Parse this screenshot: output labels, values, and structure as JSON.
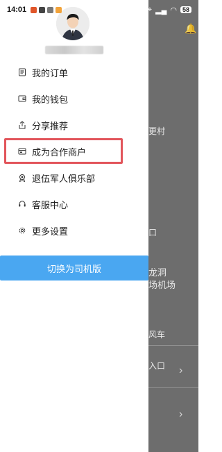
{
  "status_bar": {
    "time": "14:01",
    "battery": "58"
  },
  "drawer": {
    "menu": [
      {
        "label": "我的订单",
        "icon": "order-list-icon"
      },
      {
        "label": "我的钱包",
        "icon": "wallet-icon"
      },
      {
        "label": "分享推荐",
        "icon": "share-icon"
      },
      {
        "label": "成为合作商户",
        "icon": "merchant-card-icon"
      },
      {
        "label": "退伍军人俱乐部",
        "icon": "badge-icon"
      },
      {
        "label": "客服中心",
        "icon": "headset-icon"
      },
      {
        "label": "更多设置",
        "icon": "gear-icon"
      }
    ],
    "switch_button": "切换为司机版"
  },
  "background": {
    "labels": [
      "更村",
      "口",
      "龙洞",
      "场机场",
      "风车",
      "入口"
    ]
  },
  "colors": {
    "accent": "#4aa7f1",
    "highlight": "#e2555b"
  }
}
